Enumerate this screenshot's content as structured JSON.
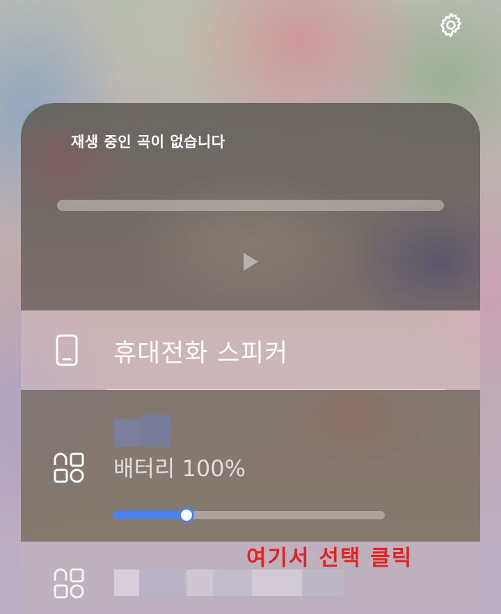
{
  "header": {
    "settings_icon": "gear-icon"
  },
  "media": {
    "no_song_text": "재생 중인 곡이 없습니다",
    "progress_value": 0,
    "play_icon": "play-icon"
  },
  "outputs": {
    "phone": {
      "icon": "smartphone-icon",
      "label": "휴대전화 스피커"
    },
    "device": {
      "icon": "device-grid-icon",
      "battery_text": "배터리 100%",
      "volume_fraction": 0.27,
      "accent_color": "#4a82f3"
    },
    "device2": {
      "icon": "device-grid-icon"
    }
  },
  "annotation": {
    "text": "여기서 선택 클릭",
    "color": "#e52222"
  }
}
